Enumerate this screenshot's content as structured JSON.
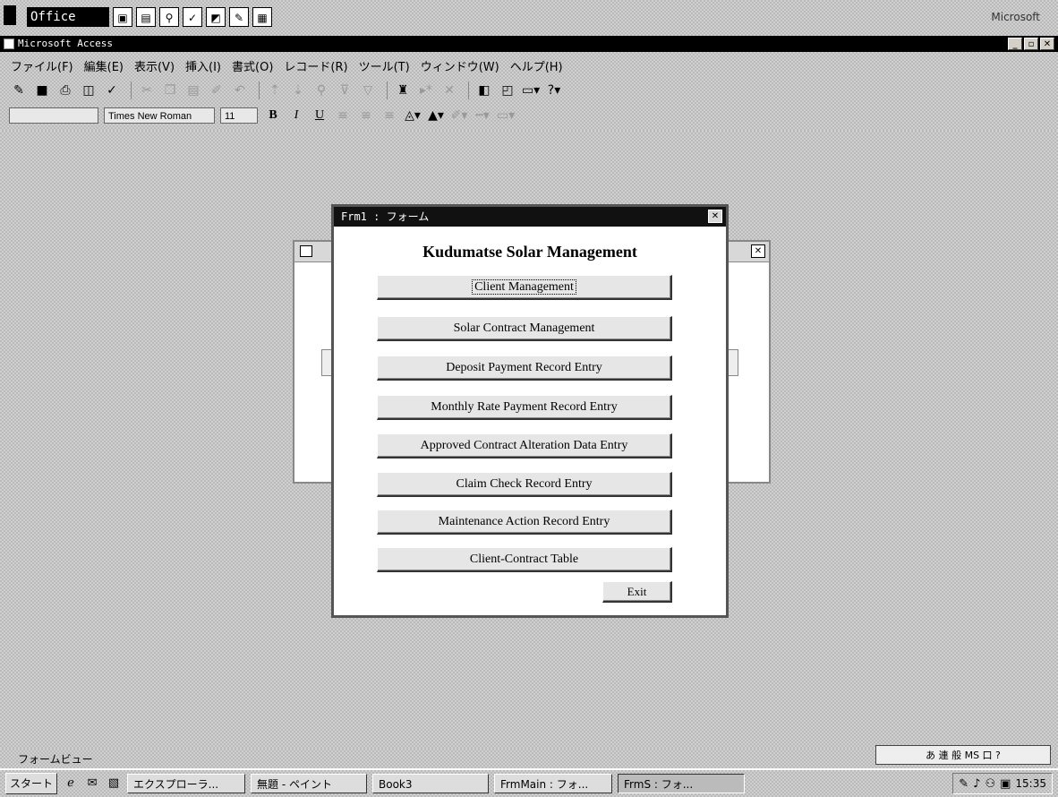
{
  "office_bar": {
    "logo": "Office",
    "right_label": "Microsoft",
    "icons": [
      "window-icon",
      "folder-icon",
      "search-icon",
      "check-icon",
      "chart-icon",
      "edit-icon",
      "grid-icon"
    ]
  },
  "app": {
    "title": "Microsoft Access"
  },
  "menu": [
    "ファイル(F)",
    "編集(E)",
    "表示(V)",
    "挿入(I)",
    "書式(O)",
    "レコード(R)",
    "ツール(T)",
    "ウィンドウ(W)",
    "ヘルプ(H)"
  ],
  "toolbar": {
    "font_name": "Times New Roman",
    "font_size": "11",
    "bold": "B",
    "italic": "I",
    "underline": "U"
  },
  "switchboard": {
    "title": "Frm1 : フォーム",
    "heading": "Kudumatse Solar Management",
    "buttons": [
      "Client Management",
      "Solar Contract Management",
      "Deposit Payment Record Entry",
      "Monthly Rate Payment Record Entry",
      "Approved Contract Alteration Data Entry",
      "Claim Check Record Entry",
      "Maintenance Action Record Entry",
      "Client-Contract Table"
    ],
    "exit_label": "Exit"
  },
  "status": {
    "text": "フォームビュー"
  },
  "taskbar": {
    "start_label": "スタート",
    "tasks": [
      "エクスプローラ...",
      "無題 - ペイント",
      "Book3",
      "FrmMain : フォ...",
      "FrmS : フォ..."
    ],
    "clock": "15:35"
  },
  "ime": {
    "label": "あ 連 般 MS 口 ?"
  }
}
